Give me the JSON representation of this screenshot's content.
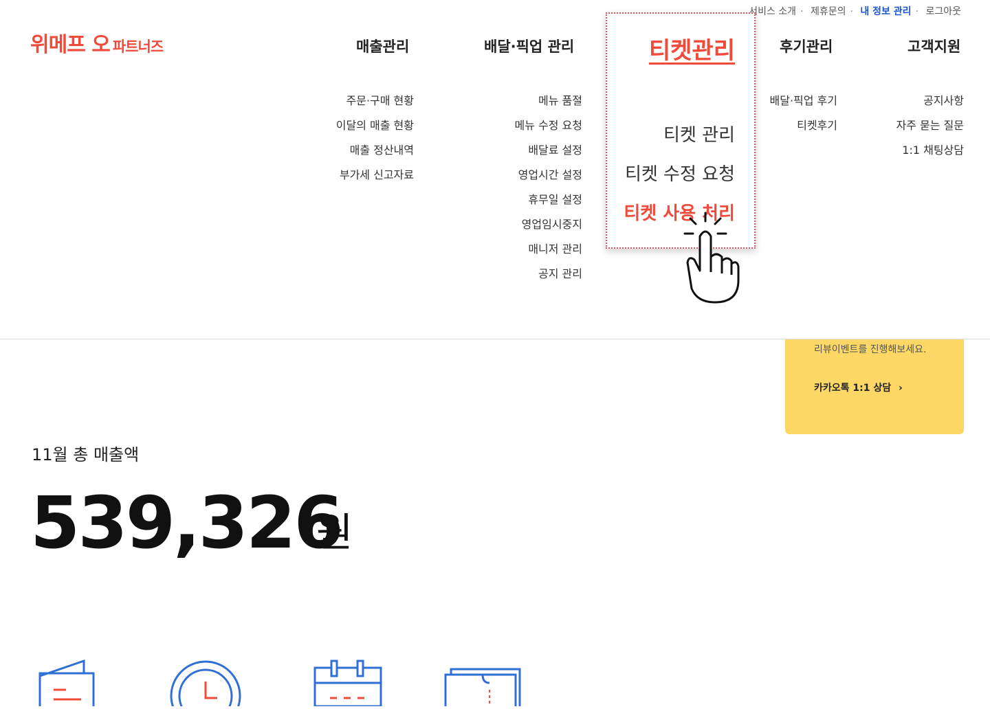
{
  "util_nav": {
    "service_intro": "서비스 소개",
    "partnership": "제휴문의",
    "my_info": "내 정보 관리",
    "logout": "로그아웃"
  },
  "logo": {
    "main": "위메프 오",
    "sub": "파트너즈"
  },
  "nav": {
    "sales": {
      "label": "매출관리",
      "items": [
        "주문·구매 현황",
        "이달의 매출 현황",
        "매출 정산내역",
        "부가세 신고자료"
      ]
    },
    "delivery": {
      "label": "배달·픽업 관리",
      "items": [
        "메뉴 품절",
        "메뉴 수정 요청",
        "배달료 설정",
        "영업시간 설정",
        "휴무일 설정",
        "영업임시중지",
        "매니저 관리",
        "공지 관리"
      ]
    },
    "ticket": {
      "label": "티켓관리",
      "items": [
        "티켓 관리",
        "티켓 수정 요청",
        "티켓 사용 처리"
      ]
    },
    "review": {
      "label": "후기관리",
      "items": [
        "배달·픽업 후기",
        "티켓후기"
      ]
    },
    "support": {
      "label": "고객지원",
      "items": [
        "공지사항",
        "자주 묻는 질문",
        "1:1 채팅상담"
      ]
    }
  },
  "banner": {
    "text": "리뷰이벤트를 진행해보세요.",
    "link": "카카오톡 1:1 상담"
  },
  "sales_summary": {
    "label": "11월 총 매출액",
    "amount": "539,326",
    "unit": "원"
  },
  "colors": {
    "brand": "#f04a3a",
    "link_blue": "#1a55d1",
    "banner_yellow": "#fdd867",
    "icon_blue": "#2f6fd6"
  }
}
